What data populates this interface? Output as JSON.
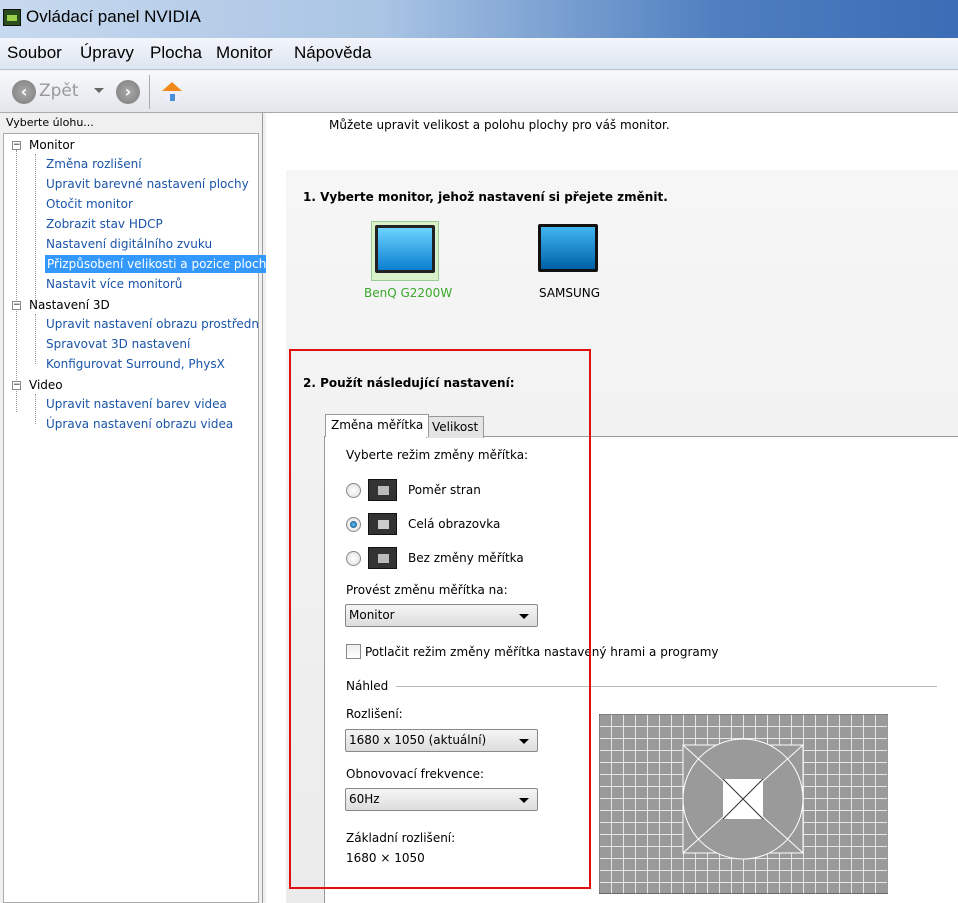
{
  "window": {
    "title": "Ovládací panel NVIDIA"
  },
  "menu": [
    "Soubor",
    "Úpravy",
    "Plocha",
    "Monitor",
    "Nápověda"
  ],
  "toolbar": {
    "back_label": "Zpět"
  },
  "sidebar": {
    "header": "Vyberte úlohu...",
    "groups": [
      {
        "label": "Monitor",
        "items": [
          "Změna rozlišení",
          "Upravit barevné nastavení plochy",
          "Otočit monitor",
          "Zobrazit stav HDCP",
          "Nastavení digitálního zvuku",
          "Přizpůsobení velikosti a pozice plochy",
          "Nastavit více monitorů"
        ]
      },
      {
        "label": "Nastavení 3D",
        "items": [
          "Upravit nastavení obrazu prostřednictvím náhledu",
          "Spravovat 3D nastavení",
          "Konfigurovat Surround, PhysX"
        ]
      },
      {
        "label": "Video",
        "items": [
          "Upravit nastavení barev videa",
          "Úprava nastavení obrazu videa"
        ]
      }
    ],
    "selected": "Přizpůsobení velikosti a pozice plochy"
  },
  "main": {
    "intro": "Můžete upravit velikost a polohu plochy pro váš monitor.",
    "step1": "1. Vyberte monitor, jehož nastavení si přejete změnit.",
    "monitors": [
      "BenQ G2200W",
      "SAMSUNG"
    ],
    "step2": "2. Použít následující nastavení:",
    "tabs": [
      "Změna měřítka",
      "Velikost"
    ],
    "scaling_mode_label": "Vyberte režim změny měřítka:",
    "modes": [
      "Poměr stran",
      "Celá obrazovka",
      "Bez změny měřítka"
    ],
    "selected_mode": "Celá obrazovka",
    "perform_on_label": "Provést změnu měřítka na:",
    "perform_on_value": "Monitor",
    "override_label": "Potlačit režim změny měřítka nastavený hrami a programy",
    "override_checked": false,
    "preview_label": "Náhled",
    "resolution_label": "Rozlišení:",
    "resolution_value": "1680 x 1050 (aktuální)",
    "refresh_label": "Obnovovací frekvence:",
    "refresh_value": "60Hz",
    "base_res_label": "Základní rozlišení:",
    "base_res_value": "1680 × 1050"
  }
}
